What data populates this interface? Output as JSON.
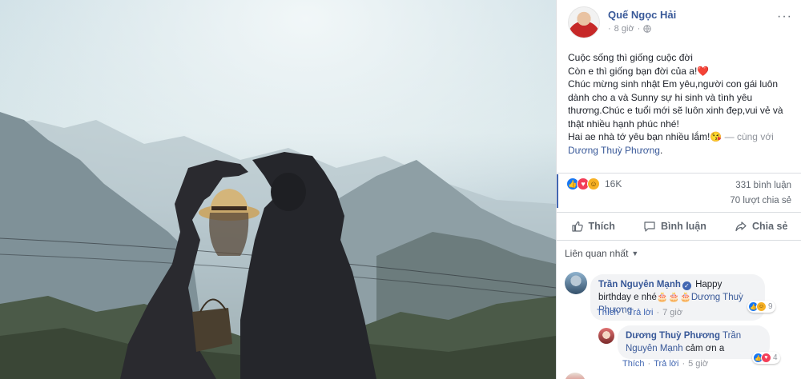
{
  "post": {
    "author": "Quế Ngọc Hải",
    "time": "8 giờ",
    "more": "···",
    "lines": [
      "Cuộc sống thì giống cuộc đời",
      "Còn e thì giống bạn đời của a!",
      "Chúc mừng sinh nhật Em yêu,người con gái luôn dành cho a và Sunny sự hi sinh và tình yêu thương.Chúc e tuổi mới sẽ luôn xinh đẹp,vui vẻ và thật nhiều hạnh phúc nhé!",
      "Hai ae nhà tớ yêu bạn nhiều lắm!"
    ],
    "heart_emoji": "❤️",
    "wink_emoji": "😘",
    "with_text": "— cùng với",
    "tagged": "Dương Thuỳ Phương"
  },
  "engagement": {
    "reactions_count": "16K",
    "comments_count": "331 bình luận",
    "shares_count": "70 lượt chia sẻ"
  },
  "actions": {
    "like": "Thích",
    "comment": "Bình luận",
    "share": "Chia sẻ"
  },
  "comments_sort": "Liên quan nhất",
  "comments": [
    {
      "author": "Trần Nguyên Mạnh",
      "verified": true,
      "text_before": "Happy birthday e nhé",
      "emoji": "🎂🎂🎂",
      "mention": "Dương Thuỳ Phương",
      "reaction_count": "9",
      "like_label": "Thích",
      "reply_label": "Trả lời",
      "time": "7 giờ"
    },
    {
      "author": "Dương Thuỳ Phương",
      "mention": "Trần Nguyên Mạnh",
      "text": "cảm ơn a",
      "reaction_count": "4",
      "like_label": "Thích",
      "reply_label": "Trả lời",
      "time": "5 giờ"
    }
  ],
  "colors": {
    "link": "#385898",
    "accent": "#4267b2",
    "like": "#1877f2",
    "love": "#f33e58",
    "haha": "#f7b125"
  }
}
